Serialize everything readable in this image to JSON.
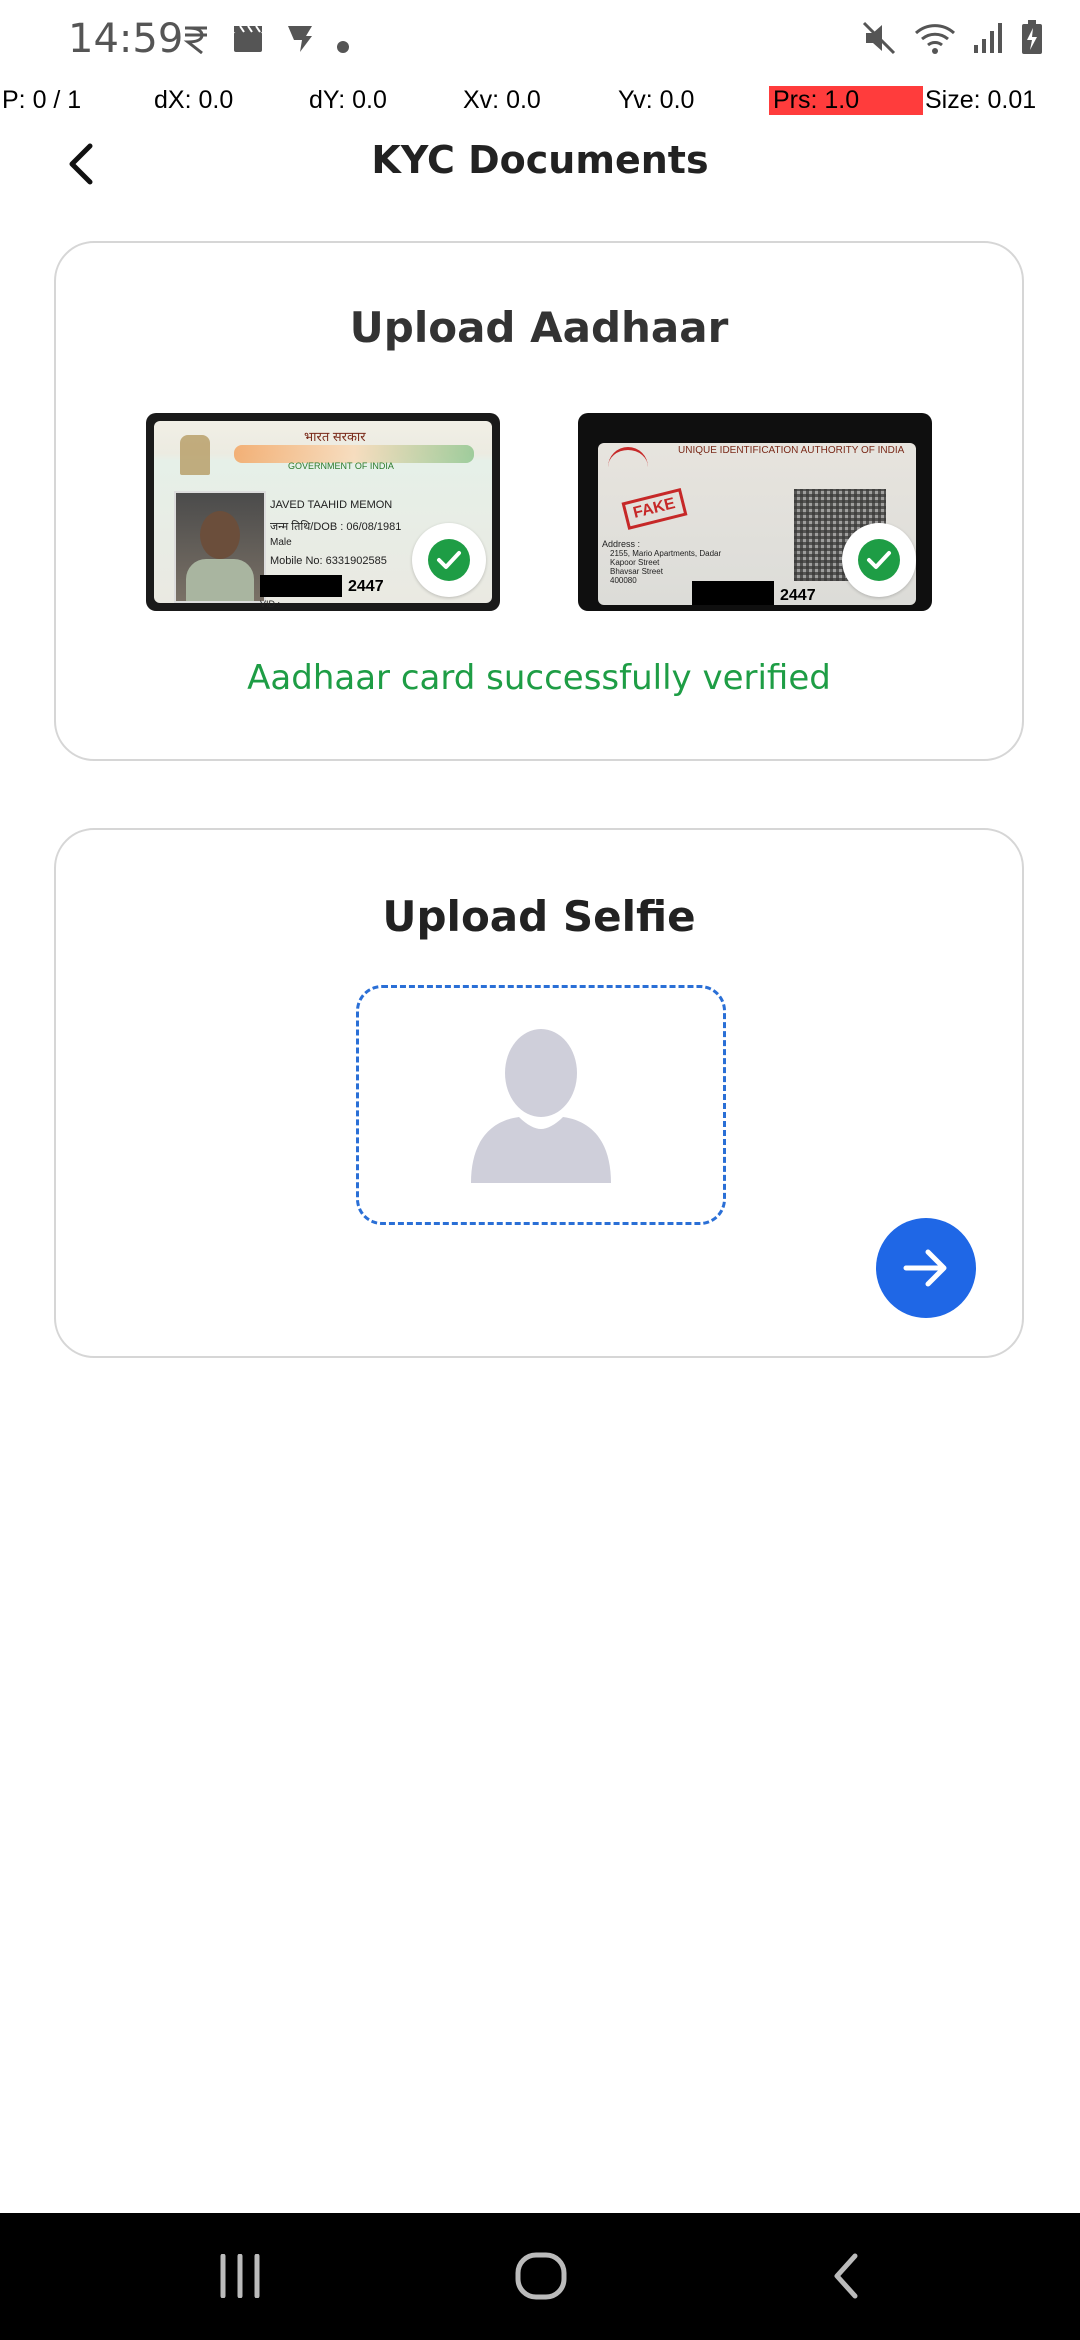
{
  "status_bar": {
    "time": "14:59",
    "left_icons": [
      "rupee-icon",
      "clapperboard-icon",
      "vpn-icon",
      "dot-icon"
    ],
    "right_icons": [
      "mute-icon",
      "wifi-icon",
      "signal-icon",
      "battery-charging-icon"
    ]
  },
  "pointer_overlay": {
    "p": "P: 0 / 1",
    "dx": "dX: 0.0",
    "dy": "dY: 0.0",
    "xv": "Xv: 0.0",
    "yv": "Yv: 0.0",
    "prs": "Prs: 1.0",
    "size": "Size: 0.01",
    "prs_color": "#ff3c3c"
  },
  "header": {
    "title": "KYC Documents"
  },
  "aadhaar_card": {
    "title": "Upload Aadhaar",
    "front": {
      "header_hi": "भारत सरकार",
      "header_en": "GOVERNMENT OF INDIA",
      "name": "JAVED TAAHID MEMON",
      "dob": "जन्म तिथि/DOB : 06/08/1981",
      "gender": "Male",
      "mobile": "Mobile No: 6331902585",
      "number_tail": "2447",
      "vid": "VID :"
    },
    "back": {
      "stamp": "FAKE",
      "authority": "UNIQUE IDENTIFICATION AUTHORITY OF INDIA",
      "address_label": "Address :",
      "address_lines": [
        "2155, Mario Apartments, Dadar",
        "Kapoor Street",
        "Bhavsar Street",
        "400080"
      ],
      "number_tail": "2447"
    },
    "status": "Aadhaar card successfully verified",
    "success_color": "#1e9d45"
  },
  "selfie_card": {
    "title": "Upload Selfie",
    "placeholder_icon": "person-placeholder-icon",
    "accent_color": "#1f67e6"
  },
  "nav_bar": {
    "items": [
      "recent-apps-icon",
      "home-icon",
      "back-icon"
    ]
  }
}
